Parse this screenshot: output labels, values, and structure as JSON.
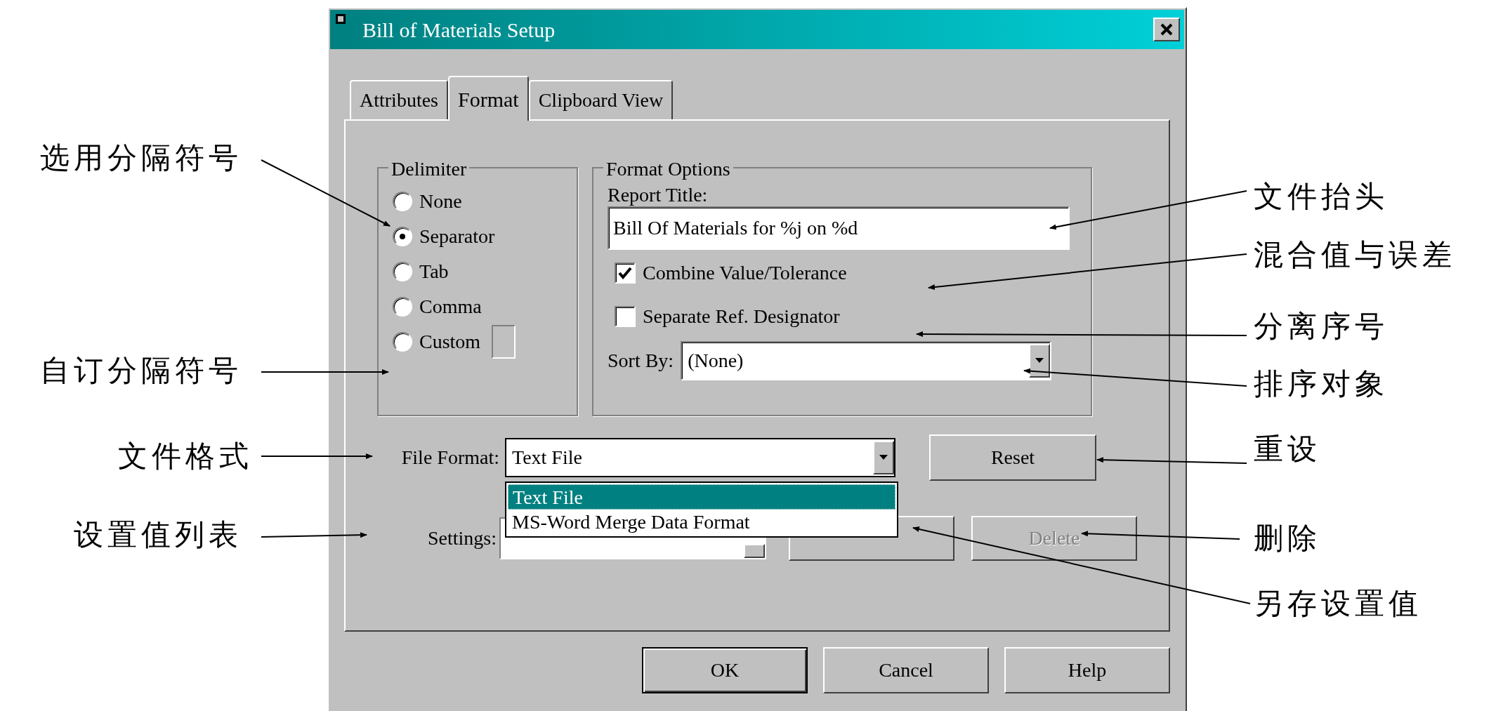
{
  "window": {
    "title": "Bill of Materials Setup"
  },
  "tabs": [
    {
      "label": "Attributes",
      "selected": false
    },
    {
      "label": "Format",
      "selected": true
    },
    {
      "label": "Clipboard View",
      "selected": false
    }
  ],
  "delimiter": {
    "title": "Delimiter",
    "options": [
      {
        "label": "None",
        "selected": false
      },
      {
        "label": "Separator",
        "selected": true
      },
      {
        "label": "Tab",
        "selected": false
      },
      {
        "label": "Comma",
        "selected": false
      },
      {
        "label": "Custom",
        "selected": false
      }
    ]
  },
  "format_options": {
    "title": "Format Options",
    "report_title_label": "Report Title:",
    "report_title_value": "Bill Of Materials for %j on %d",
    "checkboxes": [
      {
        "label": "Combine Value/Tolerance",
        "checked": true
      },
      {
        "label": "Separate Ref. Designator",
        "checked": false
      }
    ],
    "sort_by_label": "Sort By:",
    "sort_by_value": "(None)"
  },
  "file_format": {
    "label": "File Format:",
    "value": "Text File",
    "expanded": true,
    "options": [
      {
        "label": "Text File",
        "selected": true
      },
      {
        "label": "MS-Word Merge Data Format",
        "selected": false
      }
    ]
  },
  "settings": {
    "label": "Settings:"
  },
  "side_buttons": [
    {
      "label": "Reset",
      "disabled": false
    },
    {
      "label": "Delete",
      "disabled": true
    }
  ],
  "footer_buttons": [
    "OK",
    "Cancel",
    "Help"
  ],
  "annotations_left": [
    "选用分隔符号",
    "自订分隔符号",
    "文件格式",
    "设置值列表"
  ],
  "annotations_right": [
    "文件抬头",
    "混合值与误差",
    "分离序号",
    "排序对象",
    "重设",
    "删除",
    "另存设置值"
  ]
}
